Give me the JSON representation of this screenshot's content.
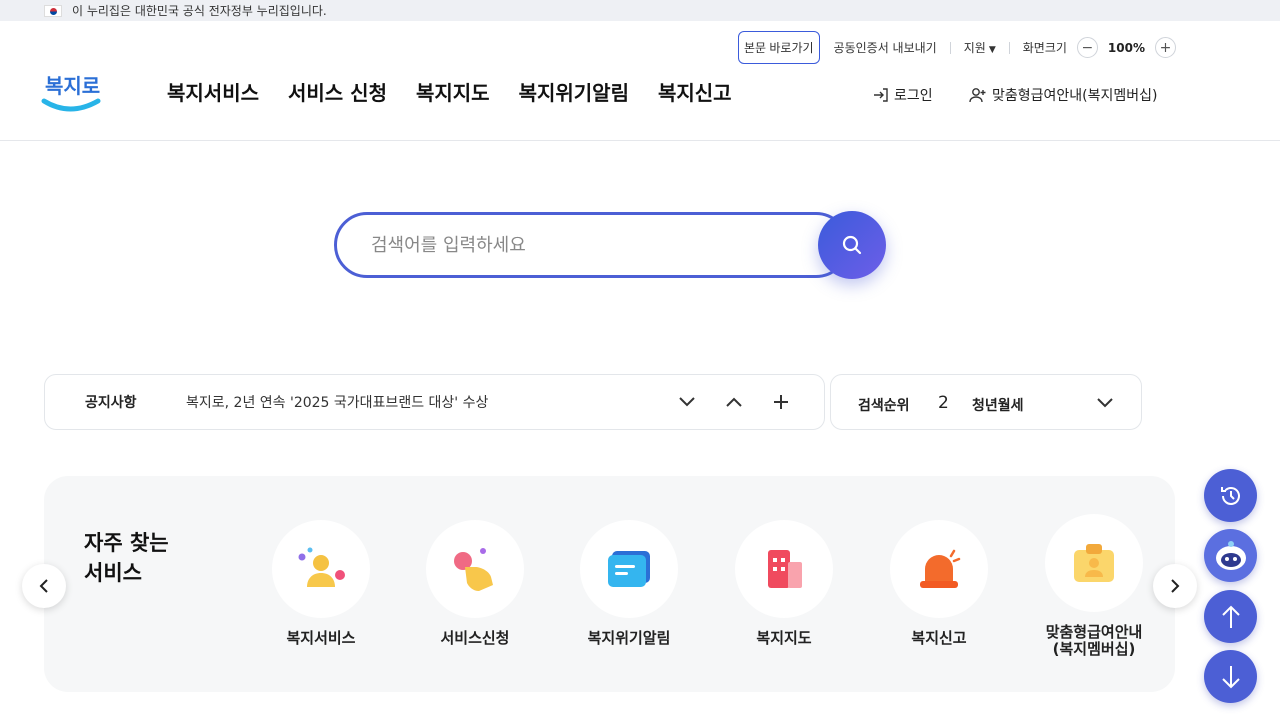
{
  "gov_banner": {
    "text": "이 누리집은 대한민국 공식 전자정부 누리집입니다."
  },
  "utility": {
    "skip": "본문 바로가기",
    "cert": "공동인증서 내보내기",
    "support": "지원",
    "zoom_label": "화면크기",
    "zoom_value": "100%"
  },
  "logo": {
    "text": "복지로"
  },
  "nav": {
    "items": [
      {
        "label": "복지서비스"
      },
      {
        "label": "서비스 신청"
      },
      {
        "label": "복지지도"
      },
      {
        "label": "복지위기알림"
      },
      {
        "label": "복지신고"
      }
    ],
    "login": "로그인",
    "member": "맞춤형급여안내(복지멤버십)"
  },
  "search": {
    "placeholder": "검색어를 입력하세요"
  },
  "notice": {
    "label": "공지사항",
    "text": "복지로, 2년 연속 '2025 국가대표브랜드 대상' 수상"
  },
  "ranking": {
    "label": "검색순위",
    "rank": "2",
    "term": "청년월세"
  },
  "frequent": {
    "title_line1": "자주 찾는",
    "title_line2": "서비스",
    "items": [
      {
        "label": "복지서비스",
        "icon": "person-icon"
      },
      {
        "label": "서비스신청",
        "icon": "hand-tap-icon"
      },
      {
        "label": "복지위기알림",
        "icon": "message-icon"
      },
      {
        "label": "복지지도",
        "icon": "building-icon"
      },
      {
        "label": "복지신고",
        "icon": "siren-icon"
      },
      {
        "label_line1": "맞춤형급여안내",
        "label_line2": "(복지멤버십)",
        "icon": "member-card-icon"
      }
    ]
  },
  "colors": {
    "brand": "#4c5fd5",
    "accent": "#6d5ee8"
  }
}
